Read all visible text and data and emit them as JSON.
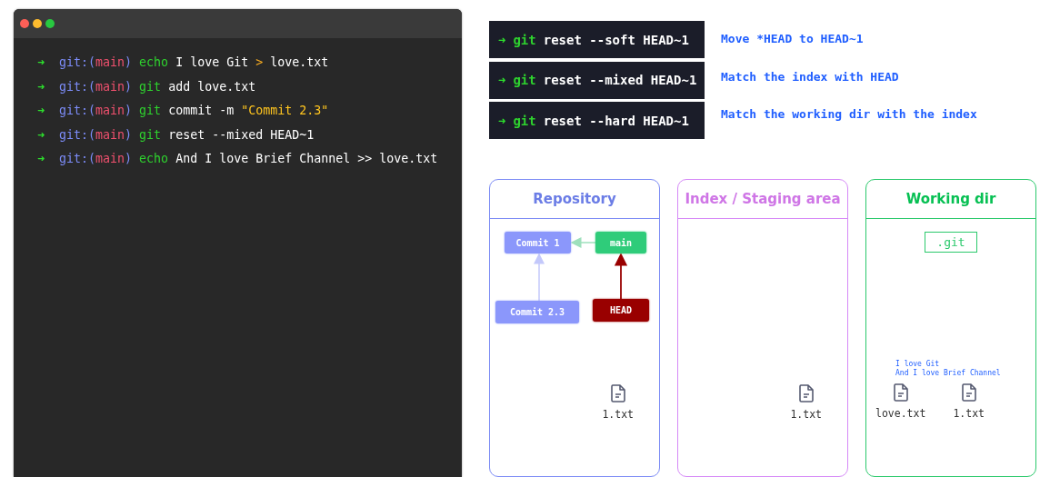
{
  "terminal": {
    "lines": [
      [
        {
          "kind": "arrow",
          "text": "➜"
        },
        {
          "kind": "prompt",
          "text": "git:("
        },
        {
          "kind": "branch",
          "text": "main"
        },
        {
          "kind": "prompt",
          "text": ")"
        },
        {
          "kind": "cmd",
          "text": "echo"
        },
        {
          "kind": "text",
          "text": "I love Git"
        },
        {
          "kind": "op",
          "text": ">"
        },
        {
          "kind": "text",
          "text": "love.txt"
        }
      ],
      [
        {
          "kind": "arrow",
          "text": "➜"
        },
        {
          "kind": "prompt",
          "text": "git:("
        },
        {
          "kind": "branch",
          "text": "main"
        },
        {
          "kind": "prompt",
          "text": ")"
        },
        {
          "kind": "cmd",
          "text": "git"
        },
        {
          "kind": "text",
          "text": "add love.txt"
        }
      ],
      [
        {
          "kind": "arrow",
          "text": "➜"
        },
        {
          "kind": "prompt",
          "text": "git:("
        },
        {
          "kind": "branch",
          "text": "main"
        },
        {
          "kind": "prompt",
          "text": ")"
        },
        {
          "kind": "cmd",
          "text": "git"
        },
        {
          "kind": "text",
          "text": "commit -m"
        },
        {
          "kind": "string",
          "text": "\"Commit 2.3\""
        }
      ],
      [
        {
          "kind": "arrow",
          "text": "➜"
        },
        {
          "kind": "prompt",
          "text": "git:("
        },
        {
          "kind": "branch",
          "text": "main"
        },
        {
          "kind": "prompt",
          "text": ")"
        },
        {
          "kind": "cmd",
          "text": "git"
        },
        {
          "kind": "text",
          "text": "reset --mixed HEAD~1"
        }
      ],
      [
        {
          "kind": "arrow",
          "text": "➜"
        },
        {
          "kind": "prompt",
          "text": "git:("
        },
        {
          "kind": "branch",
          "text": "main"
        },
        {
          "kind": "prompt",
          "text": ")"
        },
        {
          "kind": "cmd",
          "text": "echo"
        },
        {
          "kind": "text",
          "text": "And I love Brief Channel >> love.txt"
        }
      ]
    ]
  },
  "commands": [
    {
      "tokens": [
        {
          "kind": "arrow",
          "text": "➜"
        },
        {
          "kind": "cmd",
          "text": "git"
        },
        {
          "kind": "text",
          "text": "reset --soft HEAD~1"
        }
      ],
      "description": "Move *HEAD to HEAD~1"
    },
    {
      "tokens": [
        {
          "kind": "arrow",
          "text": "➜"
        },
        {
          "kind": "cmd",
          "text": "git"
        },
        {
          "kind": "text",
          "text": "reset --mixed HEAD~1"
        }
      ],
      "description": "Match the index with HEAD"
    },
    {
      "tokens": [
        {
          "kind": "arrow",
          "text": "➜"
        },
        {
          "kind": "cmd",
          "text": "git"
        },
        {
          "kind": "text",
          "text": "reset --hard HEAD~1"
        }
      ],
      "description": "Match the working dir with the index"
    }
  ],
  "panels": [
    {
      "kind": "repository",
      "title": "Repository",
      "color": "#7d8cf5",
      "nodes": [
        {
          "kind": "commit",
          "label": "Commit 1"
        },
        {
          "kind": "branch",
          "label": "main"
        },
        {
          "kind": "commit",
          "label": "Commit 2.3"
        },
        {
          "kind": "head",
          "label": "HEAD"
        }
      ],
      "files": [
        "1.txt"
      ]
    },
    {
      "kind": "index",
      "title": "Index / Staging area",
      "color": "#d68af7",
      "files": [
        "1.txt"
      ]
    },
    {
      "kind": "workdir",
      "title": "Working dir",
      "color": "#2bc96c",
      "git_box": ".git",
      "note": [
        "I love Git",
        "And I love Brief Channel"
      ],
      "files": [
        "love.txt",
        "1.txt"
      ]
    }
  ]
}
